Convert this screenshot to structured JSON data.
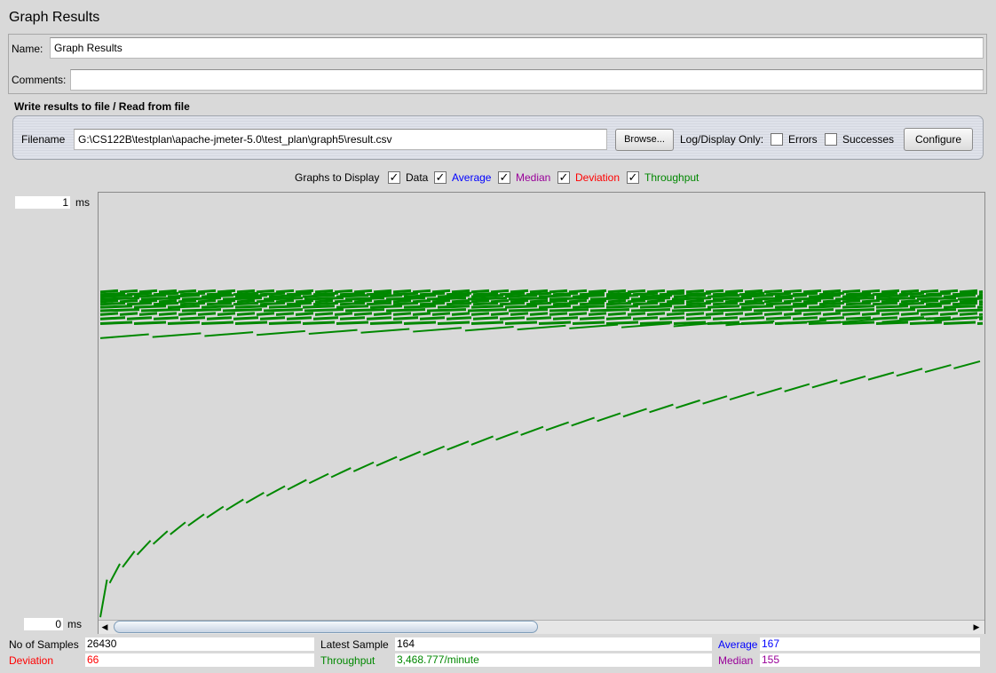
{
  "window": {
    "title": "Graph Results"
  },
  "name_field": {
    "label": "Name:",
    "value": "Graph Results"
  },
  "comments_field": {
    "label": "Comments:",
    "value": ""
  },
  "write_results": {
    "title": "Write results to file / Read from file",
    "filename_label": "Filename",
    "filename_value": "G:\\CS122B\\testplan\\apache-jmeter-5.0\\test_plan\\graph5\\result.csv",
    "browse_label": "Browse...",
    "log_display_label": "Log/Display Only:",
    "errors_label": "Errors",
    "errors_checked": false,
    "successes_label": "Successes",
    "successes_checked": false,
    "configure_label": "Configure"
  },
  "graphs_to_display": {
    "label": "Graphs to Display",
    "options": [
      {
        "label": "Data",
        "checked": true,
        "color": "#000000"
      },
      {
        "label": "Average",
        "checked": true,
        "color": "#0000ff"
      },
      {
        "label": "Median",
        "checked": true,
        "color": "#990099"
      },
      {
        "label": "Deviation",
        "checked": true,
        "color": "#ff0000"
      },
      {
        "label": "Throughput",
        "checked": true,
        "color": "#008800"
      }
    ]
  },
  "y_axis": {
    "max_value": "1",
    "min_value": "0",
    "unit": "ms"
  },
  "chart_data": {
    "type": "line",
    "title": "",
    "xlabel": "",
    "ylabel": "",
    "grid": false,
    "series": [
      {
        "name": "Throughput",
        "color": "#008800",
        "style": "segmented-rising",
        "level_top": 0.77,
        "level_bottom": 0.6
      },
      {
        "name": "Throughput",
        "color": "#008800",
        "style": "segmented-rising",
        "level_top": 0.68,
        "level_bottom": 0.64
      },
      {
        "name": "Throughput",
        "color": "#008800",
        "style": "segmented-rising",
        "level_bottom": 0.02,
        "level_top": 0.61
      }
    ]
  },
  "stats": {
    "no_of_samples_label": "No of Samples",
    "no_of_samples_value": "26430",
    "latest_sample_label": "Latest Sample",
    "latest_sample_value": "164",
    "average_label": "Average",
    "average_value": "167",
    "deviation_label": "Deviation",
    "deviation_value": "66",
    "throughput_label": "Throughput",
    "throughput_value": "3,468.777/minute",
    "median_label": "Median",
    "median_value": "155"
  },
  "colors": {
    "background": "#d9d9d9",
    "average": "#0000ff",
    "median": "#990099",
    "deviation": "#ff0000",
    "throughput": "#008800"
  }
}
